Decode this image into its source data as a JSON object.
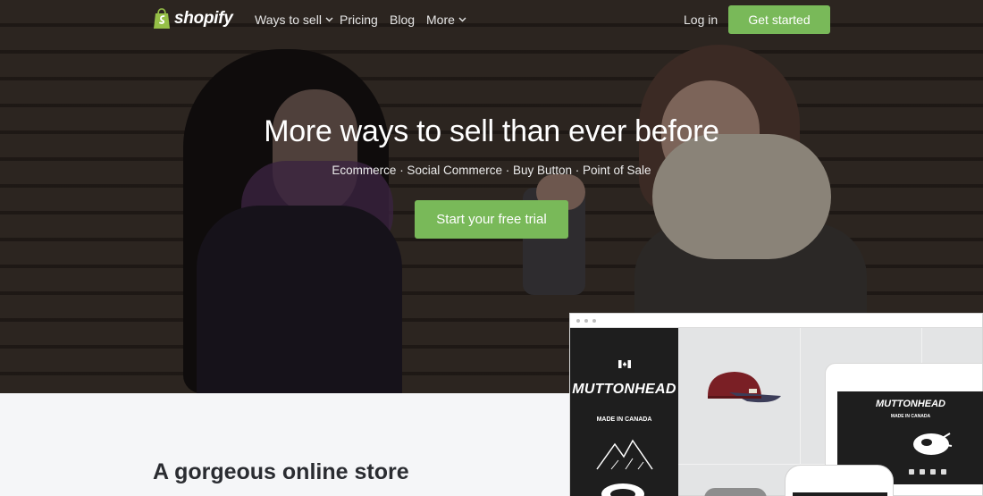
{
  "nav": {
    "logo_text": "shopify",
    "links": [
      {
        "label": "Ways to sell",
        "has_dropdown": true
      },
      {
        "label": "Pricing",
        "has_dropdown": false
      },
      {
        "label": "Blog",
        "has_dropdown": false
      },
      {
        "label": "More",
        "has_dropdown": true
      }
    ],
    "login_label": "Log in",
    "cta_label": "Get started"
  },
  "hero": {
    "title": "More ways to sell than ever before",
    "subtitle": "Ecommerce · Social Commerce · Buy Button · Point of Sale",
    "cta_label": "Start your free trial"
  },
  "section": {
    "title": "A gorgeous online store"
  },
  "mockup": {
    "brand": "MUTTONHEAD",
    "tagline": "MADE IN CANADA"
  },
  "colors": {
    "accent_green": "#79b959",
    "hero_overlay": "#2a231e",
    "section_bg": "#f5f6f8",
    "heading_text": "#2a2c31"
  },
  "icons": {
    "logo": "shopify-bag-icon",
    "dropdown": "chevron-down-icon"
  }
}
